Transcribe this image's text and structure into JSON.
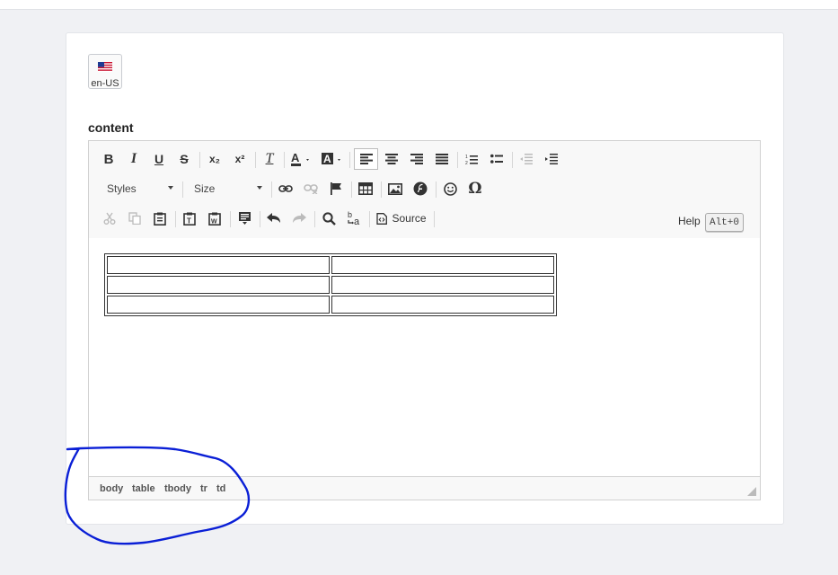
{
  "language": {
    "code": "en-US",
    "flag_icon": "us-flag-icon"
  },
  "field": {
    "label": "content"
  },
  "toolbar": {
    "row1": {
      "bold": "B",
      "italic": "I",
      "underline": "U",
      "strike": "S",
      "subscript": "x₂",
      "superscript": "x²",
      "remove_format": "T"
    },
    "row2": {
      "styles": "Styles",
      "size": "Size",
      "special_char": "Ω"
    },
    "row3": {
      "source": "Source"
    },
    "help": "Help",
    "help_shortcut": "Alt+0"
  },
  "editor_table": {
    "rows": 3,
    "cols": 2
  },
  "statusbar": {
    "path": [
      "body",
      "table",
      "tbody",
      "tr",
      "td"
    ]
  },
  "colors": {
    "annotation": "#0a1fd6",
    "toolbar_bg": "#f8f8f8",
    "border": "#d1d1d1"
  }
}
